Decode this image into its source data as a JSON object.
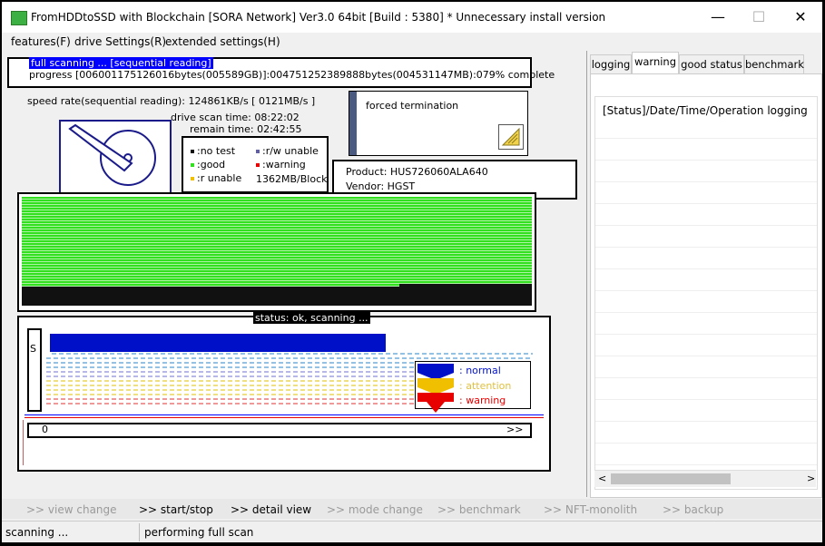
{
  "window": {
    "title": "FromHDDtoSSD with Blockchain [SORA Network] Ver3.0 64bit [Build : 5380] * Unnecessary install version",
    "controls": {
      "minimize": "—",
      "maximize": "☐",
      "close": "✕"
    }
  },
  "menu": [
    "features(F)",
    "drive Settings(R)",
    "extended settings(H)"
  ],
  "scan": {
    "mode_label": "full scanning ... [sequential reading]",
    "progress_text": "progress [006001175126016bytes(005589GB)]:004751252389888bytes(004531147MB):079% complete",
    "speed_text": "speed rate(sequential reading): 124861KB/s [ 0121MB/s ]",
    "drive_scan_time": "drive scan time: 08:22:02",
    "remain_time": "remain time: 02:42:55"
  },
  "legend": {
    "no_test": ":no test",
    "rw_unable": ":r/w unable",
    "good": ":good",
    "warning": ":warning",
    "r_unable": ":r unable",
    "block_size": "1362MB/Block"
  },
  "forced_termination": "forced termination",
  "device": {
    "product": "Product: HUS726060ALA640",
    "vendor": "Vendor: HGST"
  },
  "status_label": "status: ok, scanning ...",
  "health": {
    "s_label": "S",
    "normal": ": normal",
    "attention": ": attention",
    "warning": ": warning",
    "slider_start": "0",
    "slider_end": ">>"
  },
  "right_panel": {
    "tabs": [
      "logging",
      "warning",
      "good status",
      "benchmark"
    ],
    "active_tab": "warning",
    "header": "[Status]/Date/Time/Operation logging",
    "scroll_left": "<",
    "scroll_right": ">"
  },
  "bottom_bar": [
    {
      "label": ">> view change",
      "enabled": false
    },
    {
      "label": ">> start/stop",
      "enabled": true
    },
    {
      "label": ">> detail view",
      "enabled": true
    },
    {
      "label": ">> mode change",
      "enabled": false
    },
    {
      "label": ">> benchmark",
      "enabled": false
    },
    {
      "label": ">> NFT-monolith",
      "enabled": false
    },
    {
      "label": ">> backup",
      "enabled": false
    }
  ],
  "status_bar": {
    "left": "scanning ...",
    "right": "performing full scan"
  },
  "colors": {
    "good": "#33e01f",
    "untested": "#111111",
    "normal": "#0010c8",
    "attention": "#f0c000",
    "warning": "#e80000",
    "accent": "#0000ff"
  }
}
